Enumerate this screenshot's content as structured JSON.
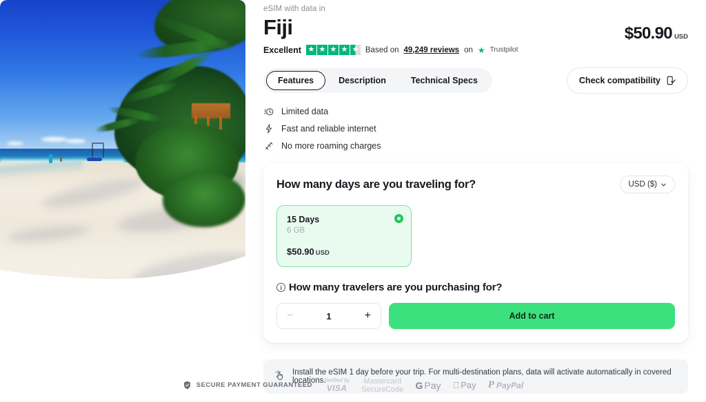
{
  "hero": {
    "alt_name": "fiji-beach-photo"
  },
  "header": {
    "eyebrow": "eSIM with data in",
    "title": "Fiji",
    "price": "$50.90",
    "price_currency": "USD"
  },
  "rating": {
    "word": "Excellent",
    "stars_filled": 4,
    "half_star": true,
    "prefix": "Based on",
    "count_link": "49,249 reviews",
    "on": "on",
    "brand": "Trustpilot"
  },
  "tabs": [
    {
      "label": "Features",
      "active": true
    },
    {
      "label": "Description",
      "active": false
    },
    {
      "label": "Technical Specs",
      "active": false
    }
  ],
  "compatibility": {
    "label": "Check compatibility",
    "icon": "device-check-icon"
  },
  "features": [
    {
      "icon": "timer-icon",
      "label": "Limited data"
    },
    {
      "icon": "lightning-bolt-icon",
      "label": "Fast and reliable internet"
    },
    {
      "icon": "no-roaming-icon",
      "label": "No more roaming charges"
    }
  ],
  "card": {
    "title": "How many days are you traveling for?",
    "currency_selector": "USD ($)",
    "plans": [
      {
        "days": "15 Days",
        "data": "6 GB",
        "price": "$50.90",
        "currency": "USD",
        "selected": true
      }
    ],
    "travelers_question": "How many travelers are you purchasing for?",
    "quantity": "1",
    "decrement": "−",
    "increment": "+",
    "add_to_cart": "Add to cart"
  },
  "notice": {
    "icon": "hand-tap-icon",
    "text": "Install the eSIM 1 day before your trip. For multi-destination plans, data will activate automatically in covered locations."
  },
  "footer": {
    "secure_label": "SECURE PAYMENT GUARANTEED",
    "payments": [
      {
        "name": "visa-verified-logo",
        "line1": "Verified by",
        "line2": "VISA"
      },
      {
        "name": "mastercard-securecode-logo",
        "line1": "Mastercard",
        "line2": "SecureCode"
      },
      {
        "name": "google-pay-logo",
        "line1": "G",
        "line2": "Pay"
      },
      {
        "name": "apple-pay-logo",
        "line1": "",
        "line2": "Pay"
      },
      {
        "name": "paypal-logo",
        "line1": "P",
        "line2": "PayPal"
      }
    ]
  },
  "colors": {
    "accent_green": "#3ce07d",
    "trustpilot_green": "#00b67a",
    "plan_bg": "#e9fbef",
    "plan_border": "#7fe0a4",
    "page_bg": "#ffffff"
  }
}
